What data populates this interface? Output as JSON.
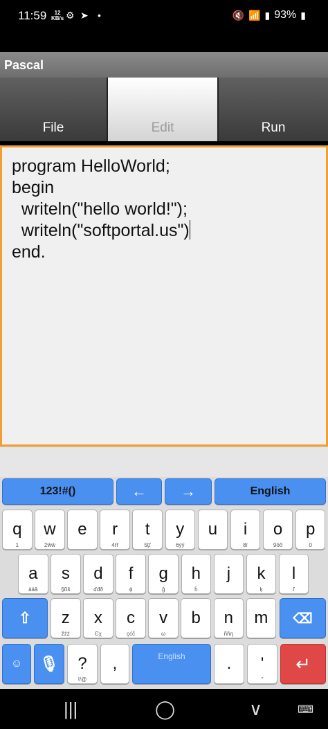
{
  "status": {
    "time": "11:59",
    "speed_value": "12",
    "speed_unit": "KB/s",
    "battery": "93%",
    "icons": [
      "gear-icon",
      "telegram-icon",
      "dot-icon",
      "mute-icon",
      "wifi-icon",
      "wifi-call-icon",
      "signal-icon"
    ]
  },
  "app": {
    "title": "Pascal"
  },
  "tabs": [
    {
      "label": "File",
      "active": false
    },
    {
      "label": "Edit",
      "active": true
    },
    {
      "label": "Run",
      "active": false
    }
  ],
  "editor": {
    "lines": [
      "program HelloWorld;",
      "begin",
      "  writeln(\"hello world!\");",
      "  writeln(\"softportal.us\")",
      "end."
    ]
  },
  "keyboard": {
    "top_row": {
      "symbols": "123!#()",
      "left_arrow": "←",
      "right_arrow": "→",
      "language": "English"
    },
    "row1": [
      {
        "k": "q",
        "s": "1"
      },
      {
        "k": "w",
        "s": "2ŵŵ"
      },
      {
        "k": "e",
        "s": ""
      },
      {
        "k": "r",
        "s": "4ŕř"
      },
      {
        "k": "t",
        "s": "5ţť"
      },
      {
        "k": "y",
        "s": "6ýÿ"
      },
      {
        "k": "u",
        "s": ""
      },
      {
        "k": "i",
        "s": "8ï"
      },
      {
        "k": "o",
        "s": "9öõ"
      },
      {
        "k": "p",
        "s": "0"
      }
    ],
    "row2": [
      {
        "k": "a",
        "s": "àáâ"
      },
      {
        "k": "s",
        "s": "§ßš"
      },
      {
        "k": "d",
        "s": "ďđð"
      },
      {
        "k": "f",
        "s": "ɸ"
      },
      {
        "k": "g",
        "s": "ğ"
      },
      {
        "k": "h",
        "s": "ĥ"
      },
      {
        "k": "j",
        "s": ""
      },
      {
        "k": "k",
        "s": "ķ"
      },
      {
        "k": "l",
        "s": "ľ"
      }
    ],
    "row3": [
      {
        "k": "z",
        "s": "žźż"
      },
      {
        "k": "x",
        "s": "Ͼχ"
      },
      {
        "k": "c",
        "s": "çćč"
      },
      {
        "k": "v",
        "s": "ω"
      },
      {
        "k": "b",
        "s": ""
      },
      {
        "k": "n",
        "s": "ñňŋ"
      },
      {
        "k": "m",
        "s": ""
      }
    ],
    "row4": {
      "question": "?",
      "question_sub": "!/@",
      "comma": ",",
      "space_label": "English",
      "period": ".",
      "quote": "'",
      "quote_sub": "\""
    }
  },
  "colors": {
    "accent": "#f0a030",
    "key_blue": "#4a90f0",
    "enter_red": "#e04848"
  }
}
